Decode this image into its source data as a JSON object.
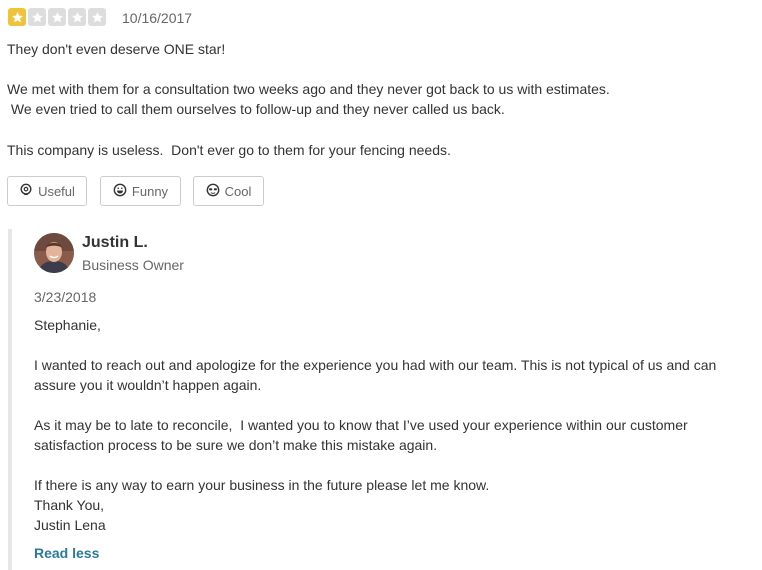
{
  "review": {
    "rating": 1,
    "rating_max": 5,
    "date": "10/16/2017",
    "lines": [
      "They don't even deserve ONE star!",
      "We met with them for a consultation two weeks ago and they never got back to us with estimates.",
      " We even tried to call them ourselves to follow-up and they never called us back.",
      "This company is useless.  Don't ever go to them for your fencing needs."
    ],
    "actions": {
      "useful": "Useful",
      "funny": "Funny",
      "cool": "Cool"
    },
    "colors": {
      "star_on": "#f0c33c",
      "star_off": "#dddddd"
    }
  },
  "response": {
    "owner_name": "Justin L.",
    "owner_role": "Business Owner",
    "date": "3/23/2018",
    "lines": [
      "Stephanie,",
      "I wanted to reach out and apologize for the experience you had with our team. This is not typical of us and can",
      "assure you it wouldn’t happen again.",
      "As it may be to late to reconcile,  I wanted you to know that I’ve used your experience within our customer",
      "satisfaction process to be sure we don’t make this mistake again.",
      "If there is any way to earn your business in the future please let me know.",
      "Thank You,",
      "Justin Lena"
    ],
    "read_less": "Read less",
    "colors": {
      "link": "#2c7a9a"
    }
  }
}
